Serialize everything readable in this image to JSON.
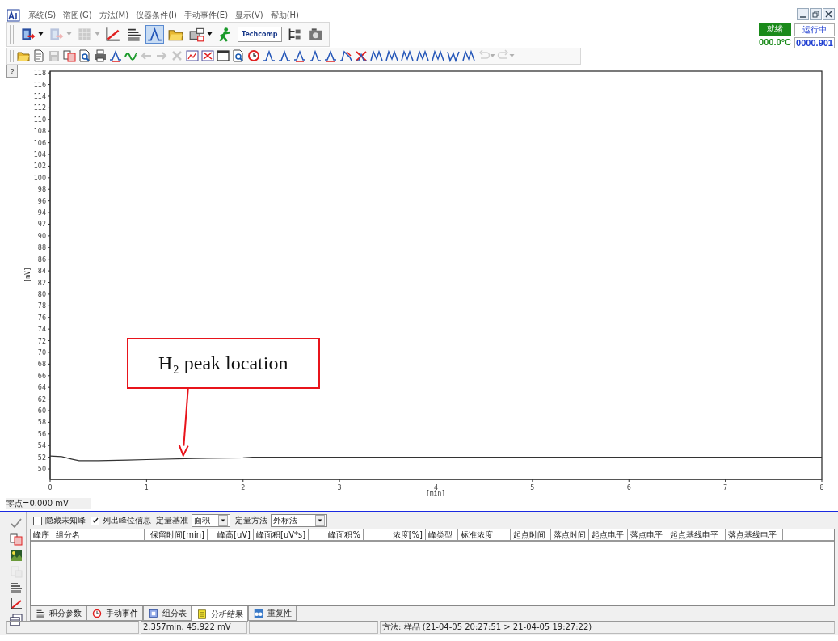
{
  "menu": [
    "系统(S)",
    "谱图(G)",
    "方法(M)",
    "仪器条件(I)",
    "手动事件(E)",
    "显示(V)",
    "帮助(H)"
  ],
  "toolbars": [
    [
      {
        "kind": "door",
        "dropdown": true,
        "disabled": false,
        "selected": false
      },
      {
        "kind": "door",
        "dropdown": true,
        "disabled": true,
        "selected": false
      },
      {
        "kind": "grid",
        "dropdown": true,
        "disabled": true,
        "selected": false
      },
      {
        "kind": "axes",
        "dropdown": false,
        "disabled": false,
        "selected": false
      },
      {
        "kind": "bars",
        "dropdown": false,
        "disabled": false,
        "selected": false
      },
      {
        "kind": "peak",
        "dropdown": false,
        "disabled": false,
        "selected": true
      },
      {
        "kind": "folder",
        "dropdown": false,
        "disabled": false,
        "selected": false
      },
      {
        "kind": "device",
        "dropdown": true,
        "disabled": false,
        "selected": false
      },
      {
        "kind": "runner",
        "dropdown": false,
        "disabled": false,
        "selected": false
      },
      {
        "kind": "logo",
        "label": "Techcomp",
        "dropdown": false,
        "disabled": false,
        "selected": false
      },
      {
        "kind": "tree",
        "dropdown": false,
        "disabled": false,
        "selected": false
      },
      {
        "kind": "camera",
        "dropdown": false,
        "disabled": false,
        "selected": false
      }
    ],
    [
      {
        "kind": "folder",
        "dropdown": false,
        "disabled": false,
        "selected": false
      },
      {
        "kind": "doc",
        "dropdown": false,
        "disabled": false,
        "selected": false
      },
      {
        "kind": "save",
        "dropdown": false,
        "disabled": true,
        "selected": false
      },
      {
        "kind": "copy",
        "dropdown": false,
        "disabled": false,
        "selected": false
      },
      {
        "kind": "preview",
        "dropdown": false,
        "disabled": false,
        "selected": false
      },
      {
        "kind": "printer",
        "dropdown": false,
        "disabled": false,
        "selected": false
      },
      {
        "kind": "peakbase",
        "dropdown": false,
        "disabled": false,
        "selected": false
      },
      {
        "kind": "wave",
        "dropdown": false,
        "disabled": false,
        "selected": false
      },
      {
        "kind": "left",
        "dropdown": false,
        "disabled": true,
        "selected": false
      },
      {
        "kind": "right",
        "dropdown": false,
        "disabled": true,
        "selected": false
      },
      {
        "kind": "delete",
        "dropdown": false,
        "disabled": true,
        "selected": false
      },
      {
        "kind": "chart",
        "dropdown": false,
        "disabled": false,
        "selected": false
      },
      {
        "kind": "chartx",
        "dropdown": false,
        "disabled": false,
        "selected": false
      },
      {
        "kind": "window",
        "dropdown": false,
        "disabled": false,
        "selected": false
      },
      {
        "kind": "preview",
        "dropdown": false,
        "disabled": false,
        "selected": false
      },
      {
        "kind": "clock",
        "dropdown": false,
        "disabled": false,
        "selected": false
      },
      {
        "kind": "peak",
        "dropdown": false,
        "disabled": false,
        "selected": false
      },
      {
        "kind": "peak",
        "dropdown": false,
        "disabled": false,
        "selected": false
      },
      {
        "kind": "peakbase",
        "dropdown": false,
        "disabled": false,
        "selected": false
      },
      {
        "kind": "peak",
        "dropdown": false,
        "disabled": false,
        "selected": false
      },
      {
        "kind": "peakbase",
        "dropdown": false,
        "disabled": false,
        "selected": false
      },
      {
        "kind": "skew",
        "dropdown": false,
        "disabled": false,
        "selected": false
      },
      {
        "kind": "crosspeak",
        "dropdown": false,
        "disabled": false,
        "selected": false
      },
      {
        "kind": "peaks",
        "dropdown": false,
        "disabled": false,
        "selected": false
      },
      {
        "kind": "peaks",
        "dropdown": false,
        "disabled": false,
        "selected": false
      },
      {
        "kind": "peaks",
        "dropdown": false,
        "disabled": false,
        "selected": false
      },
      {
        "kind": "peaks",
        "dropdown": false,
        "disabled": false,
        "selected": false
      },
      {
        "kind": "peaks",
        "dropdown": false,
        "disabled": false,
        "selected": false
      },
      {
        "kind": "valley",
        "dropdown": false,
        "disabled": false,
        "selected": false
      },
      {
        "kind": "peaks",
        "dropdown": false,
        "disabled": false,
        "selected": false
      },
      {
        "kind": "undo",
        "dropdown": true,
        "disabled": true,
        "selected": false
      },
      {
        "kind": "redo",
        "dropdown": true,
        "disabled": true,
        "selected": false
      }
    ]
  ],
  "status": {
    "state": "就绪",
    "mode": "运行中",
    "temperature": "000.0°C",
    "counter": "0000.901"
  },
  "chart": {
    "help_button": "?",
    "zero_point": "零点=0.000 mV",
    "chart_data": {
      "type": "line",
      "xlabel": "[min]",
      "ylabel": "[mV]",
      "xlim": [
        0,
        8
      ],
      "ylim": [
        48.2,
        118.3
      ],
      "xticks": [
        0,
        1,
        2,
        3,
        4,
        5,
        6,
        7,
        8
      ],
      "yticks": [
        50,
        52,
        54,
        56,
        58,
        60,
        62,
        64,
        66,
        68,
        70,
        72,
        74,
        76,
        78,
        80,
        82,
        84,
        86,
        88,
        90,
        92,
        94,
        96,
        98,
        100,
        102,
        104,
        106,
        108,
        110,
        112,
        114,
        116,
        118
      ],
      "x": [
        0,
        0.12,
        0.22,
        0.3,
        0.5,
        0.8,
        1.0,
        1.5,
        2.0,
        2.1,
        3,
        4,
        5,
        6,
        7,
        8
      ],
      "series": [
        {
          "color": "#333333",
          "values": [
            52.2,
            52.1,
            51.7,
            51.4,
            51.4,
            51.5,
            51.6,
            51.8,
            51.9,
            52.0,
            52.0,
            52.0,
            52.0,
            52.0,
            52.0,
            52.0
          ]
        }
      ],
      "annotations": [
        "H₂ peak location"
      ]
    }
  },
  "results": {
    "options": [
      {
        "kind": "checkbox",
        "label": "隐藏未知峰",
        "checked": false
      },
      {
        "kind": "checkbox",
        "label": "列出峰位信息",
        "checked": true
      },
      {
        "kind": "select",
        "label": "定量基准",
        "value": "面积"
      },
      {
        "kind": "select",
        "label": "定量方法",
        "value": "外标法"
      }
    ],
    "columns": [
      "峰序",
      "组分名",
      "保留时间[min]",
      "峰高[uV]",
      "峰面积[uV*s]",
      "峰面积%",
      "浓度[%]",
      "峰类型",
      "标准浓度",
      "起点时间",
      "落点时间",
      "起点电平",
      "落点电平",
      "起点基线电平",
      "落点基线电平"
    ],
    "tabs": [
      {
        "label": "积分参数",
        "selected": false
      },
      {
        "label": "手动事件",
        "selected": false
      },
      {
        "label": "组分表",
        "selected": false
      },
      {
        "label": "分析结果",
        "selected": true
      },
      {
        "label": "重复性",
        "selected": false
      }
    ]
  },
  "status_bar": [
    "2.357min, 45.922 mV",
    "方法: 样品 (21-04-05 20:27:51 > 21-04-05 19:27:22)"
  ]
}
